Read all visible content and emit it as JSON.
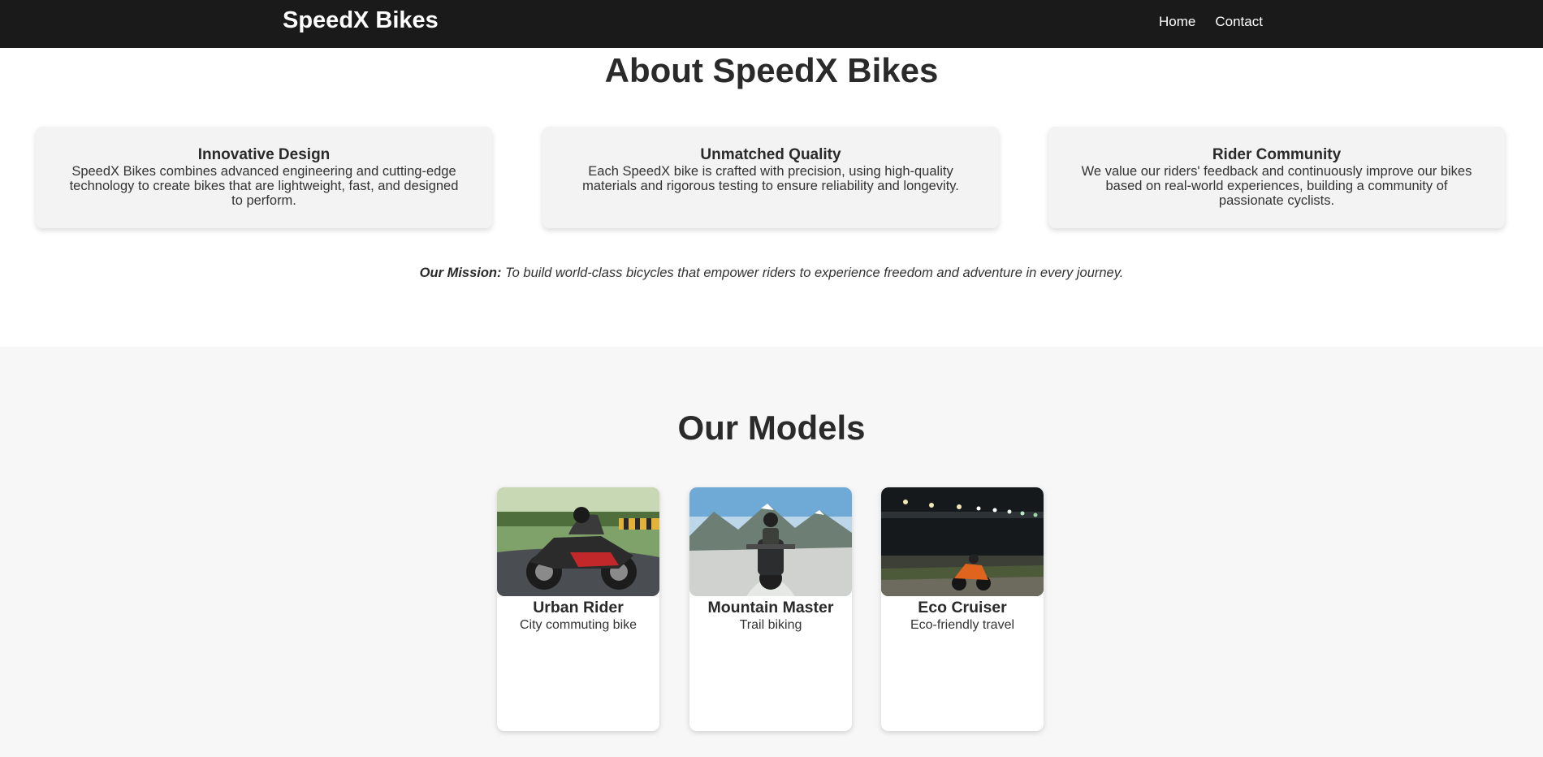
{
  "header": {
    "brand": "SpeedX Bikes",
    "nav": [
      "Home",
      "Contact"
    ]
  },
  "about": {
    "title": "About SpeedX Bikes",
    "features": [
      {
        "title": "Innovative Design",
        "description": "SpeedX Bikes combines advanced engineering and cutting-edge technology to create bikes that are lightweight, fast, and designed to perform."
      },
      {
        "title": "Unmatched Quality",
        "description": "Each SpeedX bike is crafted with precision, using high-quality materials and rigorous testing to ensure reliability and longevity."
      },
      {
        "title": "Rider Community",
        "description": "We value our riders' feedback and continuously improve our bikes based on real-world experiences, building a community of passionate cyclists."
      }
    ],
    "mission_label": "Our Mission:",
    "mission_text": "To build world-class bicycles that empower riders to experience freedom and adventure in every journey."
  },
  "models": {
    "title": "Our Models",
    "items": [
      {
        "name": "Urban Rider",
        "subtitle": "City commuting bike"
      },
      {
        "name": "Mountain Master",
        "subtitle": "Trail biking"
      },
      {
        "name": "Eco Cruiser",
        "subtitle": "Eco-friendly travel"
      }
    ]
  },
  "colors": {
    "navbar": "#1a1a1a",
    "card_bg": "#f3f3f3",
    "section_bg": "#f7f7f7",
    "text": "#2a2a2a"
  }
}
